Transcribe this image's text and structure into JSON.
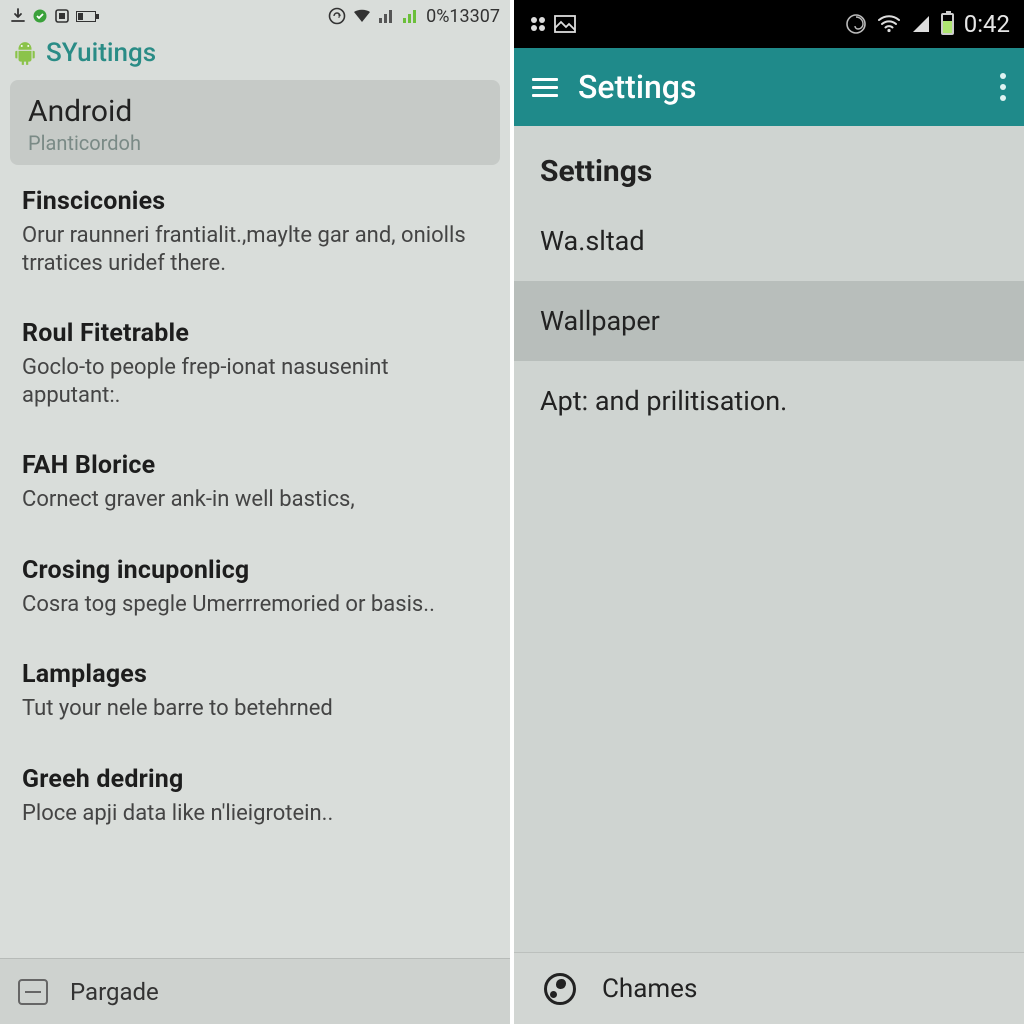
{
  "left": {
    "status": {
      "battery_text": "0%13307"
    },
    "title": "SYuitings",
    "header_card": {
      "title": "Android",
      "subtitle": "Planticordoh"
    },
    "items": [
      {
        "title": "Finsciconies",
        "desc": "Orur raunneri frantialit.,maylte gar and, oniolls trratices uridef there."
      },
      {
        "title": "Roul Fitetrable",
        "desc": "Goclo-to people frep-ionat nasusenint apputant:."
      },
      {
        "title": "FAH Blorice",
        "desc": "Cornect graver ank-in well bastics,"
      },
      {
        "title": "Crosing incuponlicg",
        "desc": "Cosra tog spegle Umerrremoried or basis.."
      },
      {
        "title": "Lamplages",
        "desc": "Tut your nele barre to betehrned"
      },
      {
        "title": "Greeh dedring",
        "desc": "Ploce apji data like n'lieigrotein.."
      }
    ],
    "bottom_label": "Pargade"
  },
  "right": {
    "status": {
      "time": "0:42"
    },
    "title": "Settings",
    "section_label": "Settings",
    "items": [
      {
        "label": "Wa.sltad",
        "selected": false
      },
      {
        "label": "Wallpaper",
        "selected": true
      },
      {
        "label": "Apt: and prilitisation.",
        "selected": false
      }
    ],
    "bottom_label": "Chames"
  }
}
